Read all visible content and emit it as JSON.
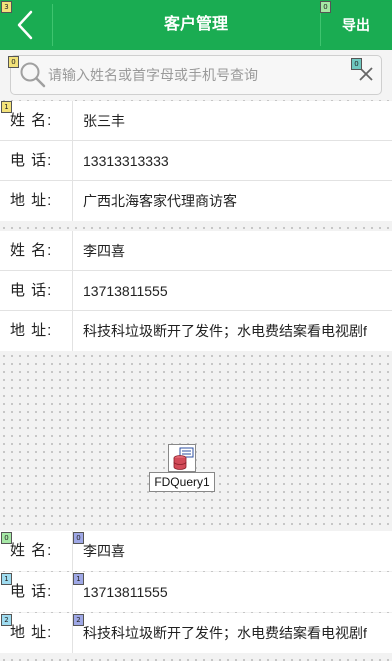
{
  "header": {
    "title": "客户管理",
    "export_label": "导出"
  },
  "search": {
    "placeholder": "请输入姓名或首字母或手机号查询"
  },
  "cards": [
    {
      "rows": [
        {
          "label": "姓 名:",
          "value": "张三丰"
        },
        {
          "label": "电 话:",
          "value": "13313313333"
        },
        {
          "label": "地 址:",
          "value": "广西北海客家代理商访客"
        }
      ]
    },
    {
      "rows": [
        {
          "label": "姓 名:",
          "value": "李四喜"
        },
        {
          "label": "电 话:",
          "value": "13713811555"
        },
        {
          "label": "地 址:",
          "value": "科技科垃圾断开了发件；水电费结案看电视剧f"
        }
      ]
    }
  ],
  "component": {
    "name": "FDQuery1"
  },
  "template_rows": [
    {
      "label": "姓 名:",
      "value": "李四喜"
    },
    {
      "label": "电 话:",
      "value": "13713811555"
    },
    {
      "label": "地 址:",
      "value": "科技科垃圾断开了发件；水电费结案看电视剧f"
    }
  ],
  "badges": {
    "header": "3",
    "export": "0",
    "search": "0",
    "clear": "0",
    "list": "1",
    "tpl_label_0": "0",
    "tpl_label_1": "1",
    "tpl_label_2": "2",
    "tpl_value_0": "0",
    "tpl_value_1": "1",
    "tpl_value_2": "2"
  },
  "colors": {
    "header_bg": "#1aac52",
    "header_text": "#ffffff",
    "divider": "#e2e2e2"
  }
}
